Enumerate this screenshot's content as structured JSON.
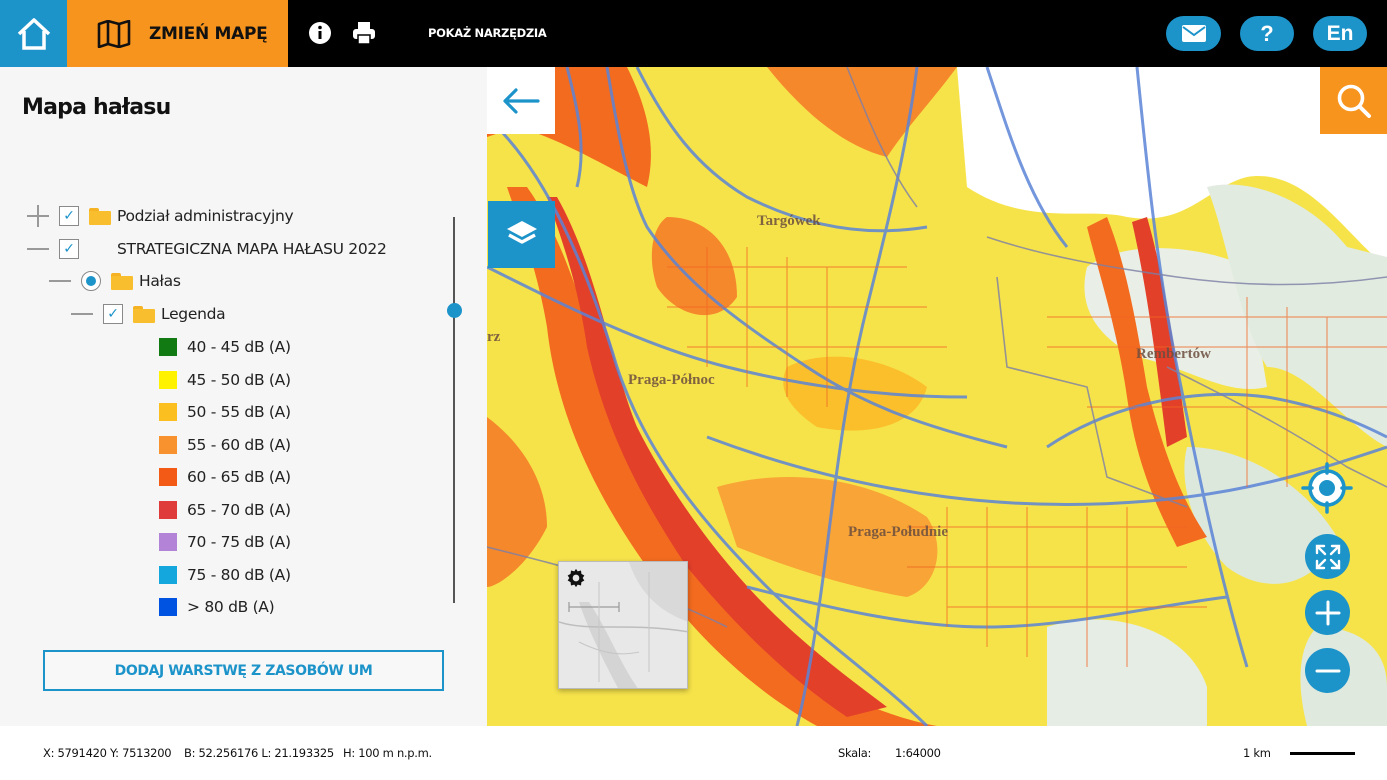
{
  "topbar": {
    "change_map_label": "ZMIEŃ MAPĘ",
    "tools_label": "POKAŻ NARZĘDZIA",
    "help_label": "?",
    "lang_label": "En",
    "icons": [
      "home-icon",
      "map-icon",
      "info-icon",
      "print-icon",
      "mail-icon"
    ]
  },
  "panel": {
    "title": "Mapa hałasu",
    "tree": [
      {
        "label": "Podział administracyjny",
        "checked": true
      },
      {
        "label": "STRATEGICZNA MAPA HAŁASU 2022",
        "checked": true
      },
      {
        "label": "Hałas",
        "selected": true
      },
      {
        "label": "Legenda",
        "checked": true
      }
    ],
    "legend": [
      {
        "label": "40 - 45 dB (A)",
        "color": "#127a12"
      },
      {
        "label": "45 - 50 dB (A)",
        "color": "#fff200"
      },
      {
        "label": "50 - 55 dB (A)",
        "color": "#fbc01f"
      },
      {
        "label": "55 - 60 dB (A)",
        "color": "#f7922f"
      },
      {
        "label": "60 - 65 dB (A)",
        "color": "#f35a15"
      },
      {
        "label": "65 - 70 dB (A)",
        "color": "#df3b3b"
      },
      {
        "label": "70 - 75 dB (A)",
        "color": "#b383d8"
      },
      {
        "label": "75 - 80 dB (A)",
        "color": "#14a7dd"
      },
      {
        "label": "> 80 dB (A)",
        "color": "#0052e0"
      }
    ],
    "add_layer_label": "DODAJ WARSTWĘ Z ZASOBÓW UM"
  },
  "map": {
    "places": [
      "Targówek",
      "Praga-Północ",
      "Rembertów",
      "Praga-Południe",
      "rz"
    ]
  },
  "status": {
    "xy": "X: 5791420 Y: 7513200",
    "bl": "B: 52.256176 L: 21.193325",
    "h": "H: 100 m n.p.m.",
    "scale_label": "Skala:",
    "scale_value": "1:64000",
    "scale_bar_label": "1 km"
  },
  "colors": {
    "accent_blue": "#1c93c9",
    "accent_orange": "#f7941d"
  }
}
